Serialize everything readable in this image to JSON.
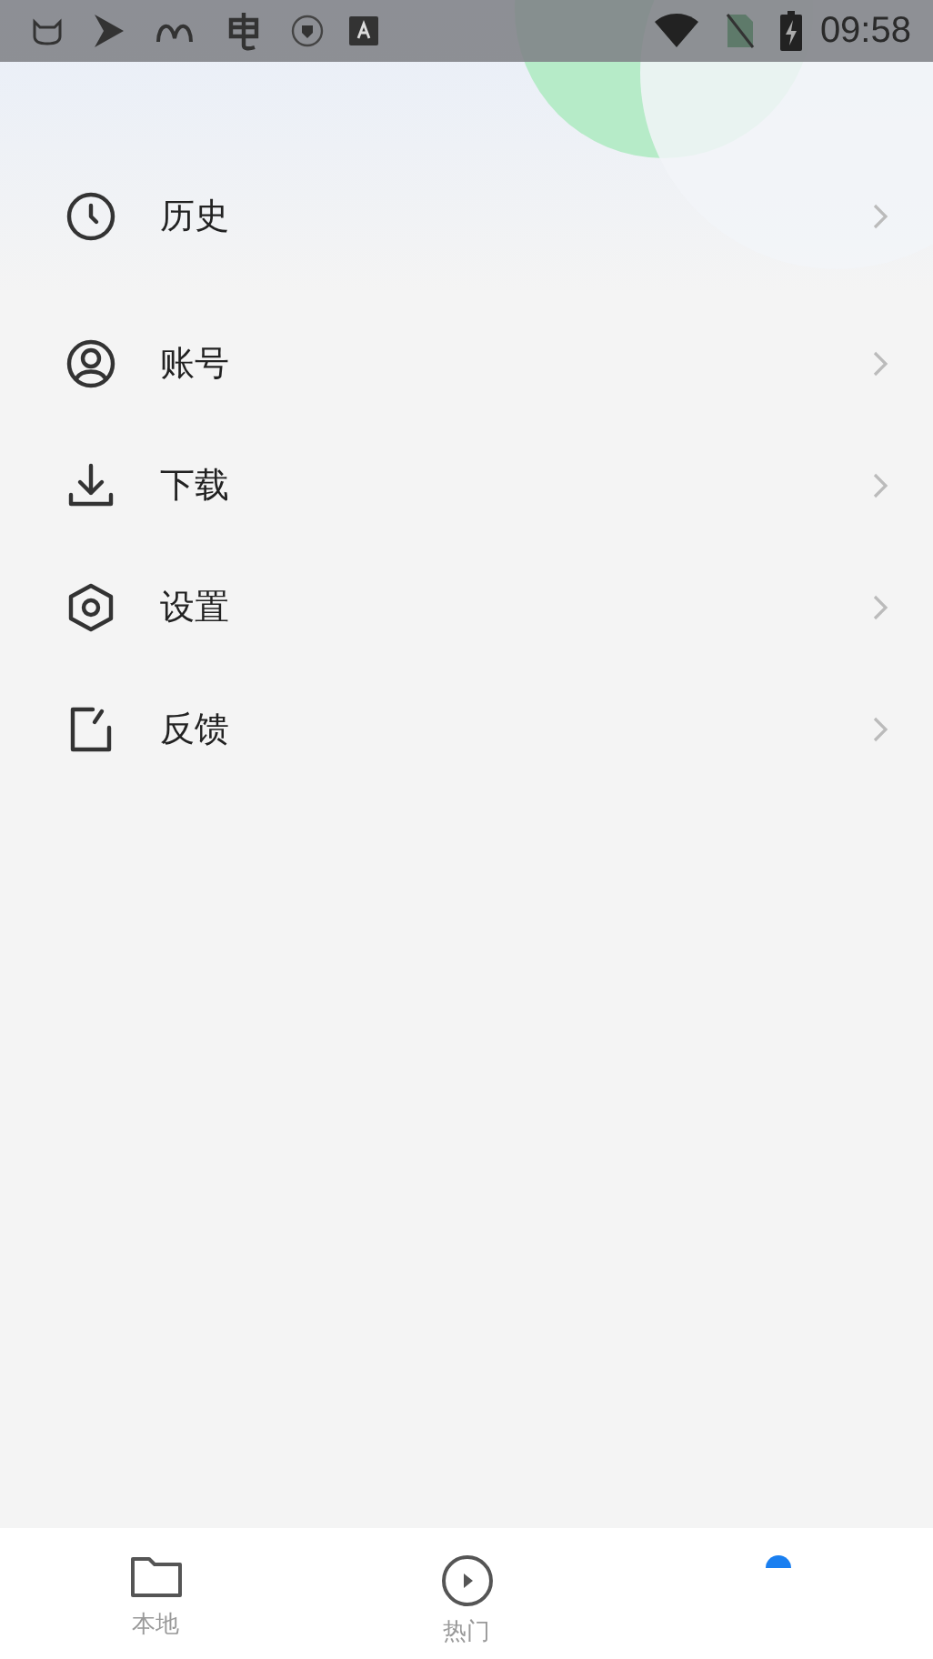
{
  "status_bar": {
    "time": "09:58"
  },
  "menu": [
    {
      "kind": "history",
      "label": "历史"
    },
    {
      "kind": "account",
      "label": "账号"
    },
    {
      "kind": "download",
      "label": "下载"
    },
    {
      "kind": "settings",
      "label": "设置"
    },
    {
      "kind": "feedback",
      "label": "反馈"
    }
  ],
  "tabs": [
    {
      "kind": "folder",
      "label": "本地",
      "selected": false
    },
    {
      "kind": "play",
      "label": "热门",
      "selected": false
    },
    {
      "kind": "profile",
      "selected": true
    }
  ]
}
